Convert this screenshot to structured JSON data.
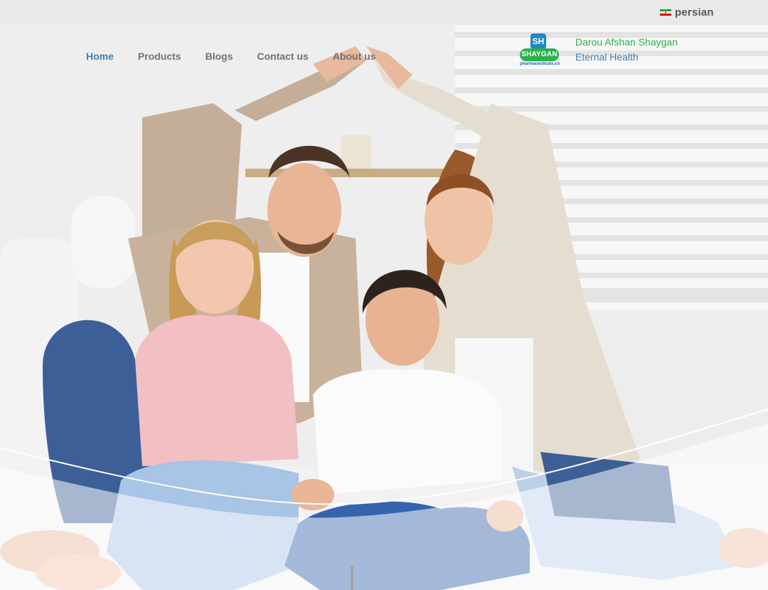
{
  "topbar": {
    "language": {
      "label": "persian",
      "flag_icon": "iran-flag-icon"
    }
  },
  "nav": {
    "items": [
      {
        "label": "Home",
        "active": true
      },
      {
        "label": "Products",
        "active": false
      },
      {
        "label": "Blogs",
        "active": false
      },
      {
        "label": "Contact us",
        "active": false
      },
      {
        "label": "About us",
        "active": false
      }
    ]
  },
  "brand": {
    "logo_mark": "SH",
    "logo_word": "SHAYGAN",
    "logo_sub": "pharmaceuticals.co",
    "name": "Darou Afshan Shaygan",
    "tagline": "Eternal Health"
  },
  "colors": {
    "nav_active": "#3d7fb4",
    "nav_default": "#707378",
    "brand_green": "#2bb04a",
    "brand_blue": "#3d7fb4"
  }
}
